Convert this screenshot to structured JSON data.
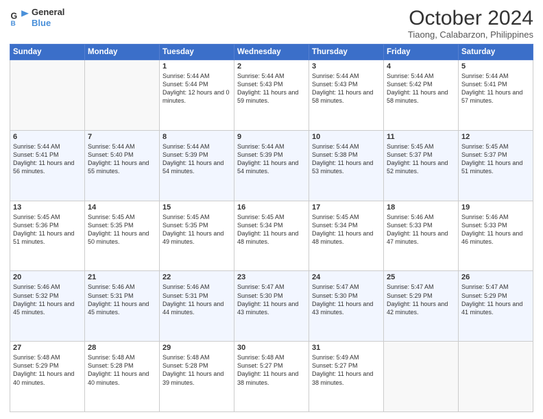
{
  "logo": {
    "line1": "General",
    "line2": "Blue"
  },
  "title": "October 2024",
  "subtitle": "Tiaong, Calabarzon, Philippines",
  "days_of_week": [
    "Sunday",
    "Monday",
    "Tuesday",
    "Wednesday",
    "Thursday",
    "Friday",
    "Saturday"
  ],
  "weeks": [
    [
      {
        "day": "",
        "info": ""
      },
      {
        "day": "",
        "info": ""
      },
      {
        "day": "1",
        "info": "Sunrise: 5:44 AM\nSunset: 5:44 PM\nDaylight: 12 hours and 0 minutes."
      },
      {
        "day": "2",
        "info": "Sunrise: 5:44 AM\nSunset: 5:43 PM\nDaylight: 11 hours and 59 minutes."
      },
      {
        "day": "3",
        "info": "Sunrise: 5:44 AM\nSunset: 5:43 PM\nDaylight: 11 hours and 58 minutes."
      },
      {
        "day": "4",
        "info": "Sunrise: 5:44 AM\nSunset: 5:42 PM\nDaylight: 11 hours and 58 minutes."
      },
      {
        "day": "5",
        "info": "Sunrise: 5:44 AM\nSunset: 5:41 PM\nDaylight: 11 hours and 57 minutes."
      }
    ],
    [
      {
        "day": "6",
        "info": "Sunrise: 5:44 AM\nSunset: 5:41 PM\nDaylight: 11 hours and 56 minutes."
      },
      {
        "day": "7",
        "info": "Sunrise: 5:44 AM\nSunset: 5:40 PM\nDaylight: 11 hours and 55 minutes."
      },
      {
        "day": "8",
        "info": "Sunrise: 5:44 AM\nSunset: 5:39 PM\nDaylight: 11 hours and 54 minutes."
      },
      {
        "day": "9",
        "info": "Sunrise: 5:44 AM\nSunset: 5:39 PM\nDaylight: 11 hours and 54 minutes."
      },
      {
        "day": "10",
        "info": "Sunrise: 5:44 AM\nSunset: 5:38 PM\nDaylight: 11 hours and 53 minutes."
      },
      {
        "day": "11",
        "info": "Sunrise: 5:45 AM\nSunset: 5:37 PM\nDaylight: 11 hours and 52 minutes."
      },
      {
        "day": "12",
        "info": "Sunrise: 5:45 AM\nSunset: 5:37 PM\nDaylight: 11 hours and 51 minutes."
      }
    ],
    [
      {
        "day": "13",
        "info": "Sunrise: 5:45 AM\nSunset: 5:36 PM\nDaylight: 11 hours and 51 minutes."
      },
      {
        "day": "14",
        "info": "Sunrise: 5:45 AM\nSunset: 5:35 PM\nDaylight: 11 hours and 50 minutes."
      },
      {
        "day": "15",
        "info": "Sunrise: 5:45 AM\nSunset: 5:35 PM\nDaylight: 11 hours and 49 minutes."
      },
      {
        "day": "16",
        "info": "Sunrise: 5:45 AM\nSunset: 5:34 PM\nDaylight: 11 hours and 48 minutes."
      },
      {
        "day": "17",
        "info": "Sunrise: 5:45 AM\nSunset: 5:34 PM\nDaylight: 11 hours and 48 minutes."
      },
      {
        "day": "18",
        "info": "Sunrise: 5:46 AM\nSunset: 5:33 PM\nDaylight: 11 hours and 47 minutes."
      },
      {
        "day": "19",
        "info": "Sunrise: 5:46 AM\nSunset: 5:33 PM\nDaylight: 11 hours and 46 minutes."
      }
    ],
    [
      {
        "day": "20",
        "info": "Sunrise: 5:46 AM\nSunset: 5:32 PM\nDaylight: 11 hours and 45 minutes."
      },
      {
        "day": "21",
        "info": "Sunrise: 5:46 AM\nSunset: 5:31 PM\nDaylight: 11 hours and 45 minutes."
      },
      {
        "day": "22",
        "info": "Sunrise: 5:46 AM\nSunset: 5:31 PM\nDaylight: 11 hours and 44 minutes."
      },
      {
        "day": "23",
        "info": "Sunrise: 5:47 AM\nSunset: 5:30 PM\nDaylight: 11 hours and 43 minutes."
      },
      {
        "day": "24",
        "info": "Sunrise: 5:47 AM\nSunset: 5:30 PM\nDaylight: 11 hours and 43 minutes."
      },
      {
        "day": "25",
        "info": "Sunrise: 5:47 AM\nSunset: 5:29 PM\nDaylight: 11 hours and 42 minutes."
      },
      {
        "day": "26",
        "info": "Sunrise: 5:47 AM\nSunset: 5:29 PM\nDaylight: 11 hours and 41 minutes."
      }
    ],
    [
      {
        "day": "27",
        "info": "Sunrise: 5:48 AM\nSunset: 5:29 PM\nDaylight: 11 hours and 40 minutes."
      },
      {
        "day": "28",
        "info": "Sunrise: 5:48 AM\nSunset: 5:28 PM\nDaylight: 11 hours and 40 minutes."
      },
      {
        "day": "29",
        "info": "Sunrise: 5:48 AM\nSunset: 5:28 PM\nDaylight: 11 hours and 39 minutes."
      },
      {
        "day": "30",
        "info": "Sunrise: 5:48 AM\nSunset: 5:27 PM\nDaylight: 11 hours and 38 minutes."
      },
      {
        "day": "31",
        "info": "Sunrise: 5:49 AM\nSunset: 5:27 PM\nDaylight: 11 hours and 38 minutes."
      },
      {
        "day": "",
        "info": ""
      },
      {
        "day": "",
        "info": ""
      }
    ]
  ]
}
